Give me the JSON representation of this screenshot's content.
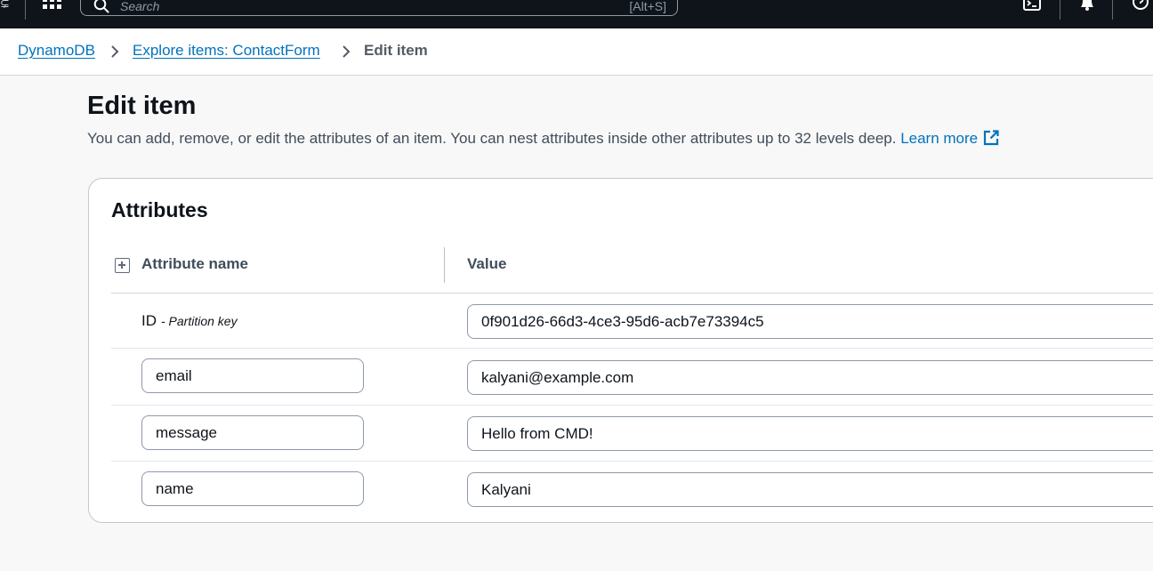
{
  "topbar": {
    "search_placeholder": "Search",
    "search_shortcut": "[Alt+S]",
    "icons": [
      "apps-grid-icon",
      "search-icon",
      "cloudshell-icon",
      "notifications-bell-icon",
      "help-icon"
    ]
  },
  "breadcrumb": {
    "items": [
      {
        "label": "DynamoDB"
      },
      {
        "label": "Explore items: ContactForm"
      },
      {
        "label": "Edit item"
      }
    ]
  },
  "page": {
    "title": "Edit item",
    "description": "You can add, remove, or edit the attributes of an item. You can nest attributes inside other attributes up to 32 levels deep.",
    "learn_more": "Learn more"
  },
  "attributes": {
    "title": "Attributes",
    "columns": {
      "name": "Attribute name",
      "value": "Value"
    },
    "partition_key": {
      "name": "ID",
      "note": "- Partition key",
      "value": "0f901d26-66d3-4ce3-95d6-acb7e73394c5"
    },
    "rows": [
      {
        "name": "email",
        "value": "kalyani@example.com"
      },
      {
        "name": "message",
        "value": "Hello from CMD!"
      },
      {
        "name": "name",
        "value": "Kalyani"
      }
    ]
  },
  "colors": {
    "nav_bg": "#0f141a",
    "link": "#0073bb",
    "page_bg": "#f8f8f8",
    "border": "#8d99a8"
  }
}
